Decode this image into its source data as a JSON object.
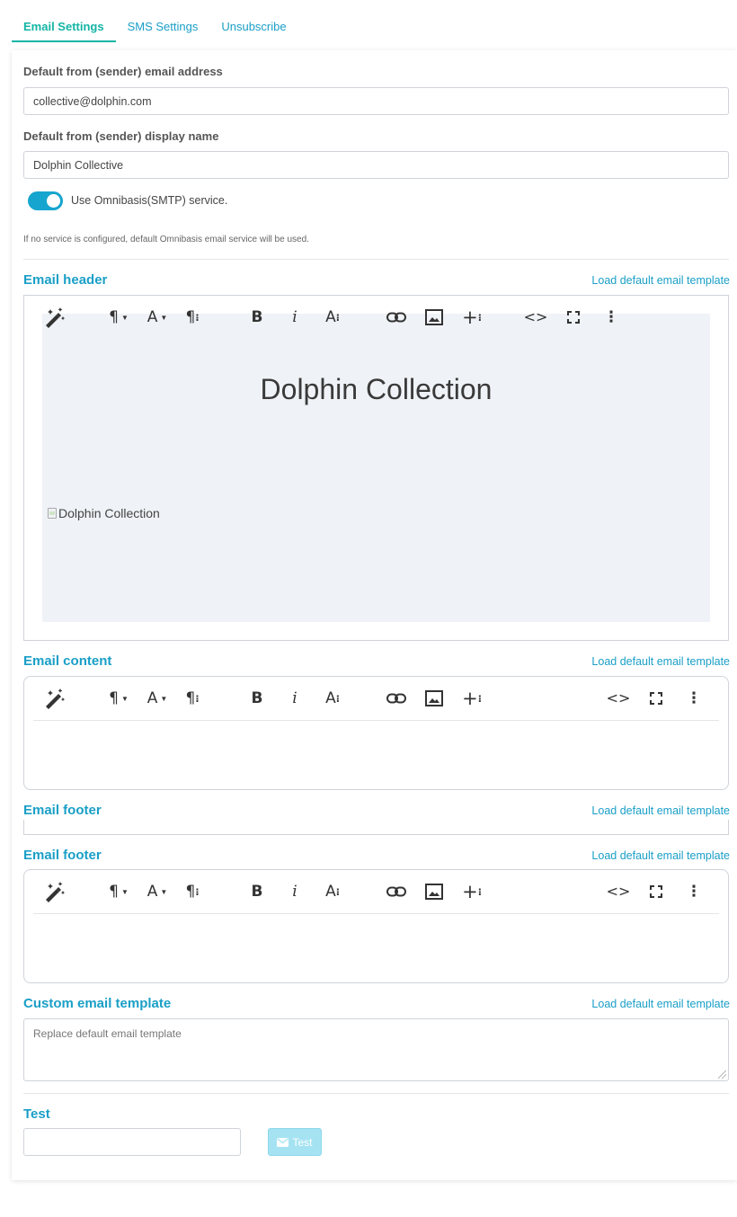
{
  "tabs": [
    {
      "label": "Email Settings",
      "active": true
    },
    {
      "label": "SMS Settings",
      "active": false
    },
    {
      "label": "Unsubscribe",
      "active": false
    }
  ],
  "sender": {
    "email_label": "Default from (sender) email address",
    "email_value": "collective@dolphin.com",
    "name_label": "Default from (sender) display name",
    "name_value": "Dolphin Collective"
  },
  "smtp": {
    "toggle_on": true,
    "label": "Use Omnibasis(SMTP) service.",
    "note": "If no service is configured, default Omnibasis email service will be used."
  },
  "sections": {
    "header": {
      "title": "Email header",
      "link": "Load default email template"
    },
    "content": {
      "title": "Email content",
      "link": "Load default email template"
    },
    "footer_a": {
      "title": "Email footer",
      "link": "Load default email template"
    },
    "footer_b": {
      "title": "Email footer",
      "link": "Load default email template"
    },
    "custom": {
      "title": "Custom email template",
      "link": "Load default email template",
      "placeholder": "Replace default email template"
    }
  },
  "header_canvas": {
    "title": "Dolphin Collection",
    "image_alt": "Dolphin Collection"
  },
  "test": {
    "title": "Test",
    "input_value": "",
    "button_label": "Test"
  },
  "colors": {
    "accent": "#1a9fc7",
    "tab_active": "#13b5a5",
    "toggle": "#16a5cf",
    "test_button": "#a6e3f2",
    "canvas_bg": "#eff2f6"
  }
}
